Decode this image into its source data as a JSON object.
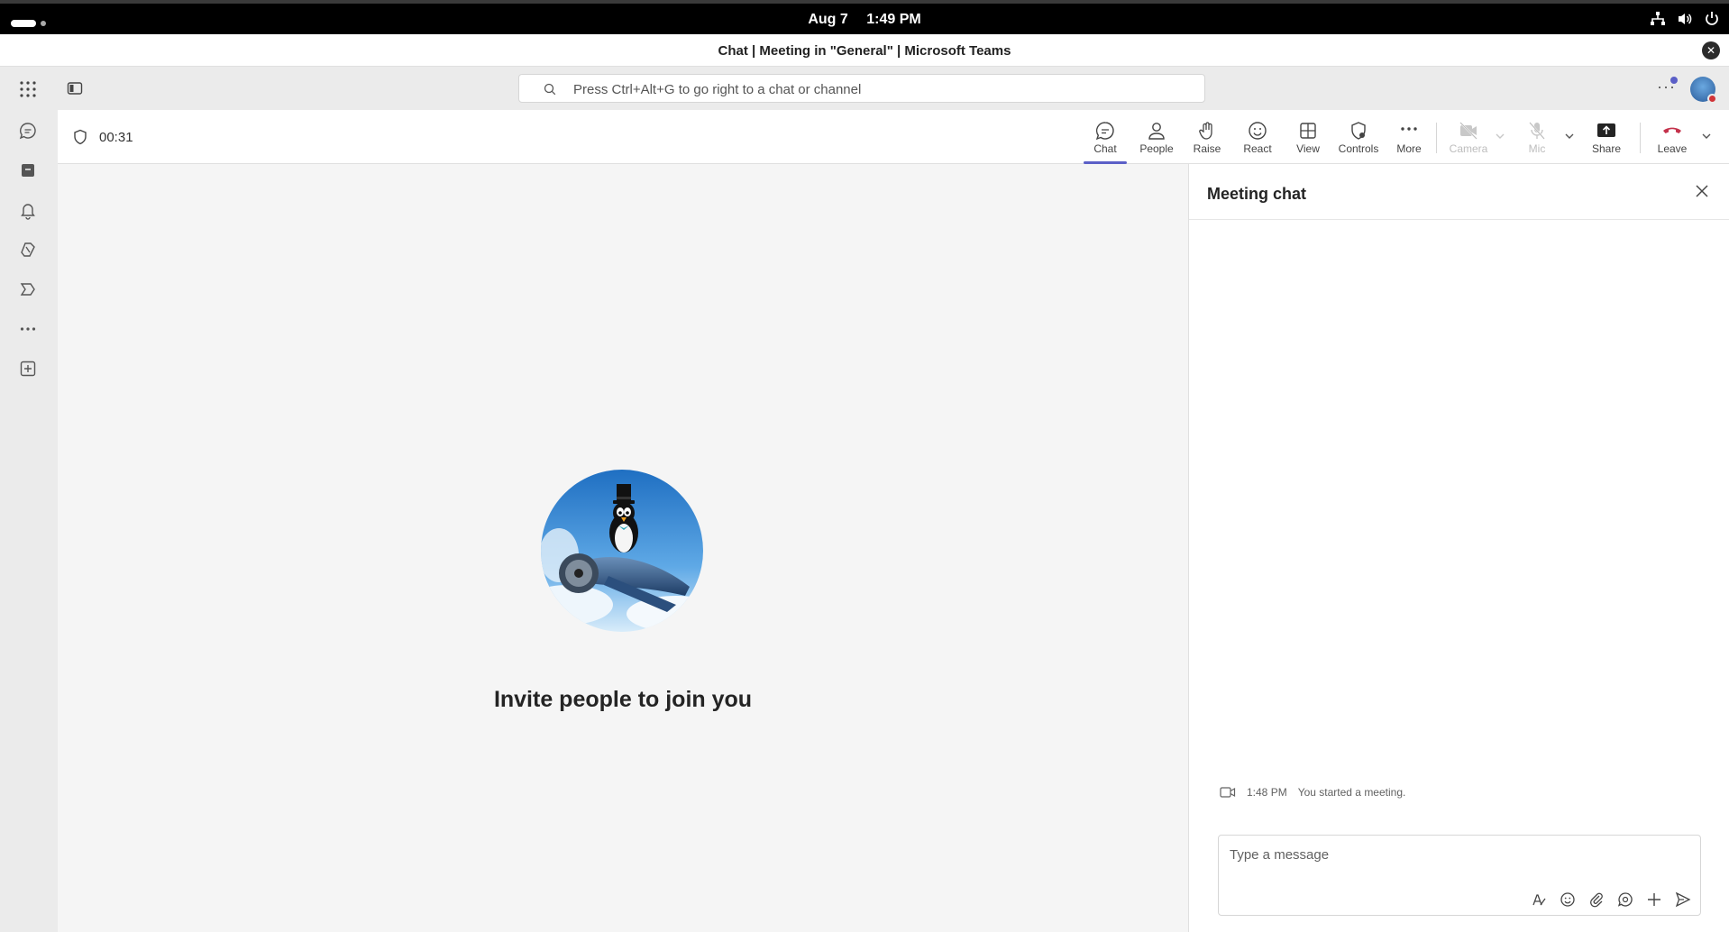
{
  "os": {
    "date": "Aug 7",
    "time": "1:49 PM"
  },
  "window": {
    "title": "Chat | Meeting in \"General\" | Microsoft Teams"
  },
  "search": {
    "placeholder": "Press Ctrl+Alt+G to go right to a chat or channel"
  },
  "meeting": {
    "timer": "00:31",
    "toolbar": {
      "chat": "Chat",
      "people": "People",
      "raise": "Raise",
      "react": "React",
      "view": "View",
      "controls": "Controls",
      "more": "More",
      "camera": "Camera",
      "mic": "Mic",
      "share": "Share",
      "leave": "Leave"
    },
    "invite_text": "Invite people to join you"
  },
  "chat_panel": {
    "title": "Meeting chat",
    "system_message": {
      "time": "1:48 PM",
      "text": "You started a meeting."
    },
    "composer_placeholder": "Type a message"
  },
  "colors": {
    "accent": "#5b5fc7",
    "leave": "#c4314b",
    "presence_busy": "#d13438"
  }
}
